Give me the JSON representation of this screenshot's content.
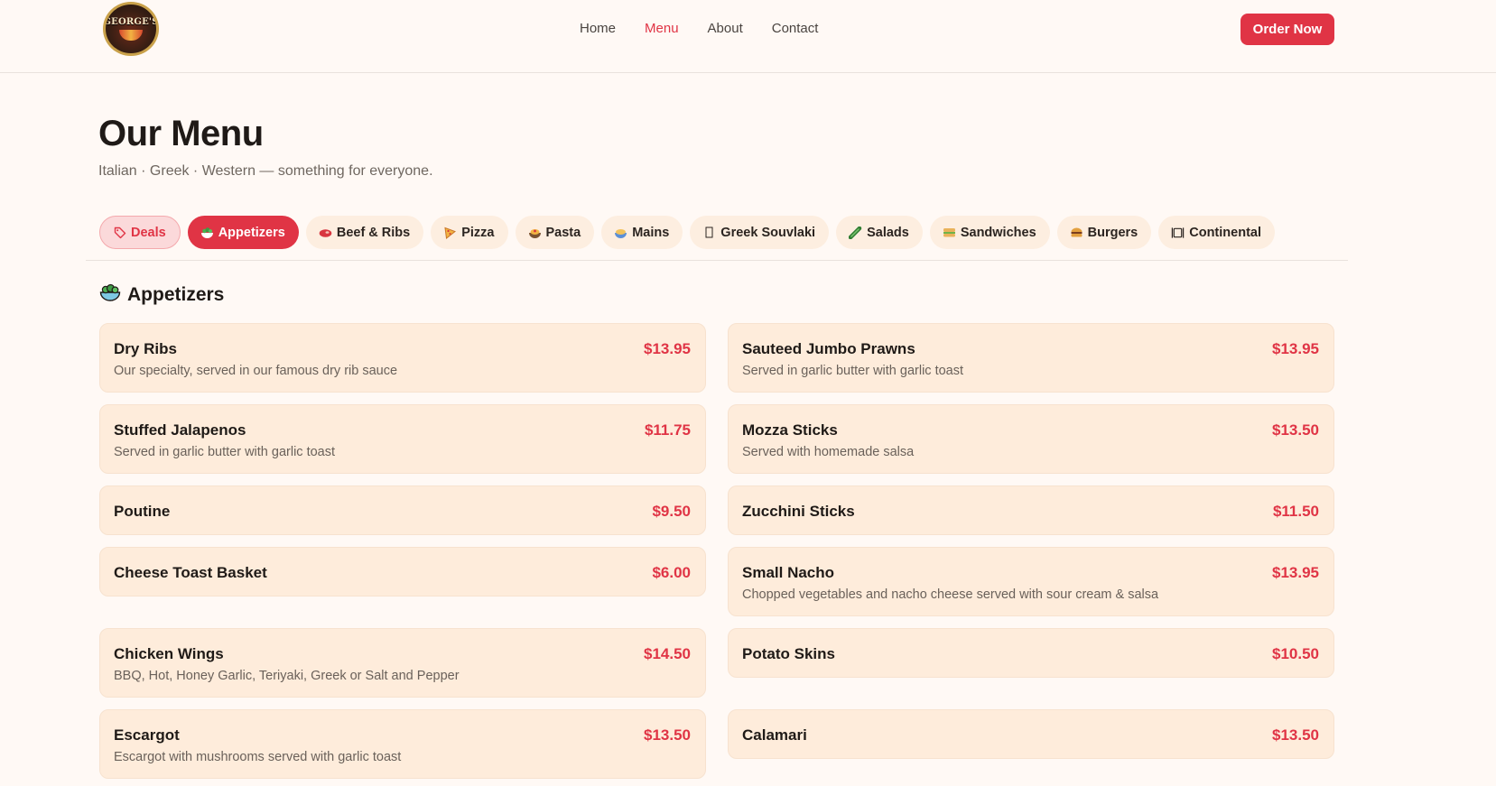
{
  "header": {
    "logo_text": "GEORGE'S",
    "nav": [
      "Home",
      "Menu",
      "About",
      "Contact"
    ],
    "active_nav": "Menu",
    "order_button": "Order Now"
  },
  "page": {
    "title": "Our Menu",
    "subtitle": "Italian · Greek · Western — something for everyone."
  },
  "tabs": [
    {
      "label": "Deals",
      "icon": "tag-icon"
    },
    {
      "label": "Appetizers",
      "icon": "salad-bowl-icon"
    },
    {
      "label": "Beef & Ribs",
      "icon": "steak-icon"
    },
    {
      "label": "Pizza",
      "icon": "pizza-icon"
    },
    {
      "label": "Pasta",
      "icon": "pasta-icon"
    },
    {
      "label": "Mains",
      "icon": "bowl-icon"
    },
    {
      "label": "Greek Souvlaki",
      "icon": "missing-glyph-icon"
    },
    {
      "label": "Salads",
      "icon": "cucumber-icon"
    },
    {
      "label": "Sandwiches",
      "icon": "sandwich-icon"
    },
    {
      "label": "Burgers",
      "icon": "burger-icon"
    },
    {
      "label": "Continental",
      "icon": "plate-icon"
    }
  ],
  "active_tab": "Appetizers",
  "section": {
    "title": "Appetizers",
    "icon": "salad-bowl-icon"
  },
  "items": [
    {
      "name": "Dry Ribs",
      "price": "$13.95",
      "desc": "Our specialty, served in our famous dry rib sauce"
    },
    {
      "name": "Sauteed Jumbo Prawns",
      "price": "$13.95",
      "desc": "Served in garlic butter with garlic toast"
    },
    {
      "name": "Stuffed Jalapenos",
      "price": "$11.75",
      "desc": "Served in garlic butter with garlic toast"
    },
    {
      "name": "Mozza Sticks",
      "price": "$13.50",
      "desc": "Served with homemade salsa"
    },
    {
      "name": "Poutine",
      "price": "$9.50",
      "desc": ""
    },
    {
      "name": "Zucchini Sticks",
      "price": "$11.50",
      "desc": ""
    },
    {
      "name": "Cheese Toast Basket",
      "price": "$6.00",
      "desc": ""
    },
    {
      "name": "Small Nacho",
      "price": "$13.95",
      "desc": "Chopped vegetables and nacho cheese served with sour cream & salsa"
    },
    {
      "name": "Chicken Wings",
      "price": "$14.50",
      "desc": "BBQ, Hot, Honey Garlic, Teriyaki, Greek or Salt and Pepper"
    },
    {
      "name": "Potato Skins",
      "price": "$10.50",
      "desc": ""
    },
    {
      "name": "Escargot",
      "price": "$13.50",
      "desc": "Escargot with mushrooms served with garlic toast"
    },
    {
      "name": "Calamari",
      "price": "$13.50",
      "desc": ""
    }
  ],
  "colors": {
    "accent": "#e03445",
    "background": "#fff9f5",
    "card": "#feecdb",
    "tab": "#fdeee0"
  }
}
